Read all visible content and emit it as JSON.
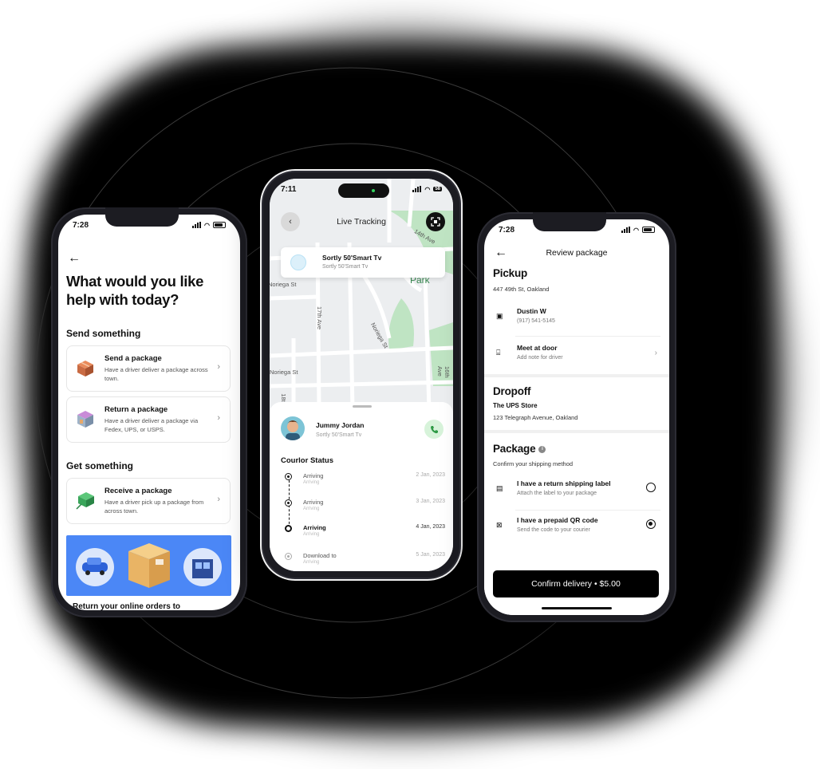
{
  "left_phone": {
    "time": "7:28",
    "heading": "What would you like help with today?",
    "send_section": "Send something",
    "send_options": [
      {
        "title": "Send a package",
        "desc": "Have a driver deliver a package across town."
      },
      {
        "title": "Return a package",
        "desc": "Have a driver deliver a package via Fedex, UPS, or USPS."
      }
    ],
    "get_section": "Get something",
    "get_options": [
      {
        "title": "Receive a package",
        "desc": "Have a driver pick up a package from across town."
      }
    ],
    "promo_text": "Return your online orders to"
  },
  "middle_phone": {
    "time": "7:11",
    "battery": "58",
    "title": "Live Tracking",
    "item_title": "Sortly 50'Smart Tv",
    "item_sub": "Sortly 50'Smart Tv",
    "streets": [
      "14th Ave",
      "Park",
      "Noriega St",
      "17th Ave",
      "Noriega St",
      "Noriega St",
      "18th",
      "16th Ave"
    ],
    "driver_name": "Jummy Jordan",
    "driver_sub": "Sortly 50'Smart Tv",
    "status_heading": "Courlor Status",
    "timeline": [
      {
        "label": "Arriving",
        "sub": "Arriving",
        "date": "2 Jan, 2023"
      },
      {
        "label": "Arriving",
        "sub": "Arriving",
        "date": "3 Jan, 2023"
      },
      {
        "label": "Arriving",
        "sub": "Arriving",
        "date": "4 Jan, 2023"
      },
      {
        "label": "Download to",
        "sub": "Arriving",
        "date": "5 Jan, 2023"
      }
    ]
  },
  "right_phone": {
    "time": "7:28",
    "title": "Review package",
    "pickup_heading": "Pickup",
    "pickup_address": "447 49th St, Oakland",
    "contact_name": "Dustin W",
    "contact_phone": "(917) 541-5145",
    "meet_title": "Meet at door",
    "meet_sub": "Add note for driver",
    "dropoff_heading": "Dropoff",
    "dropoff_name": "The UPS Store",
    "dropoff_address": "123 Telegraph Avenue, Oakland",
    "package_heading": "Package",
    "package_sub": "Confirm your shipping method",
    "methods": [
      {
        "title": "I have a return shipping label",
        "desc": "Attach the label to your package",
        "selected": false
      },
      {
        "title": "I have a prepaid QR code",
        "desc": "Send the code to your courier",
        "selected": true
      }
    ],
    "confirm_label": "Confirm delivery • $5.00"
  },
  "colors": {
    "promo_blue": "#4b87f6",
    "call_green": "#d7f3da",
    "park_green": "#bfe4c3"
  }
}
